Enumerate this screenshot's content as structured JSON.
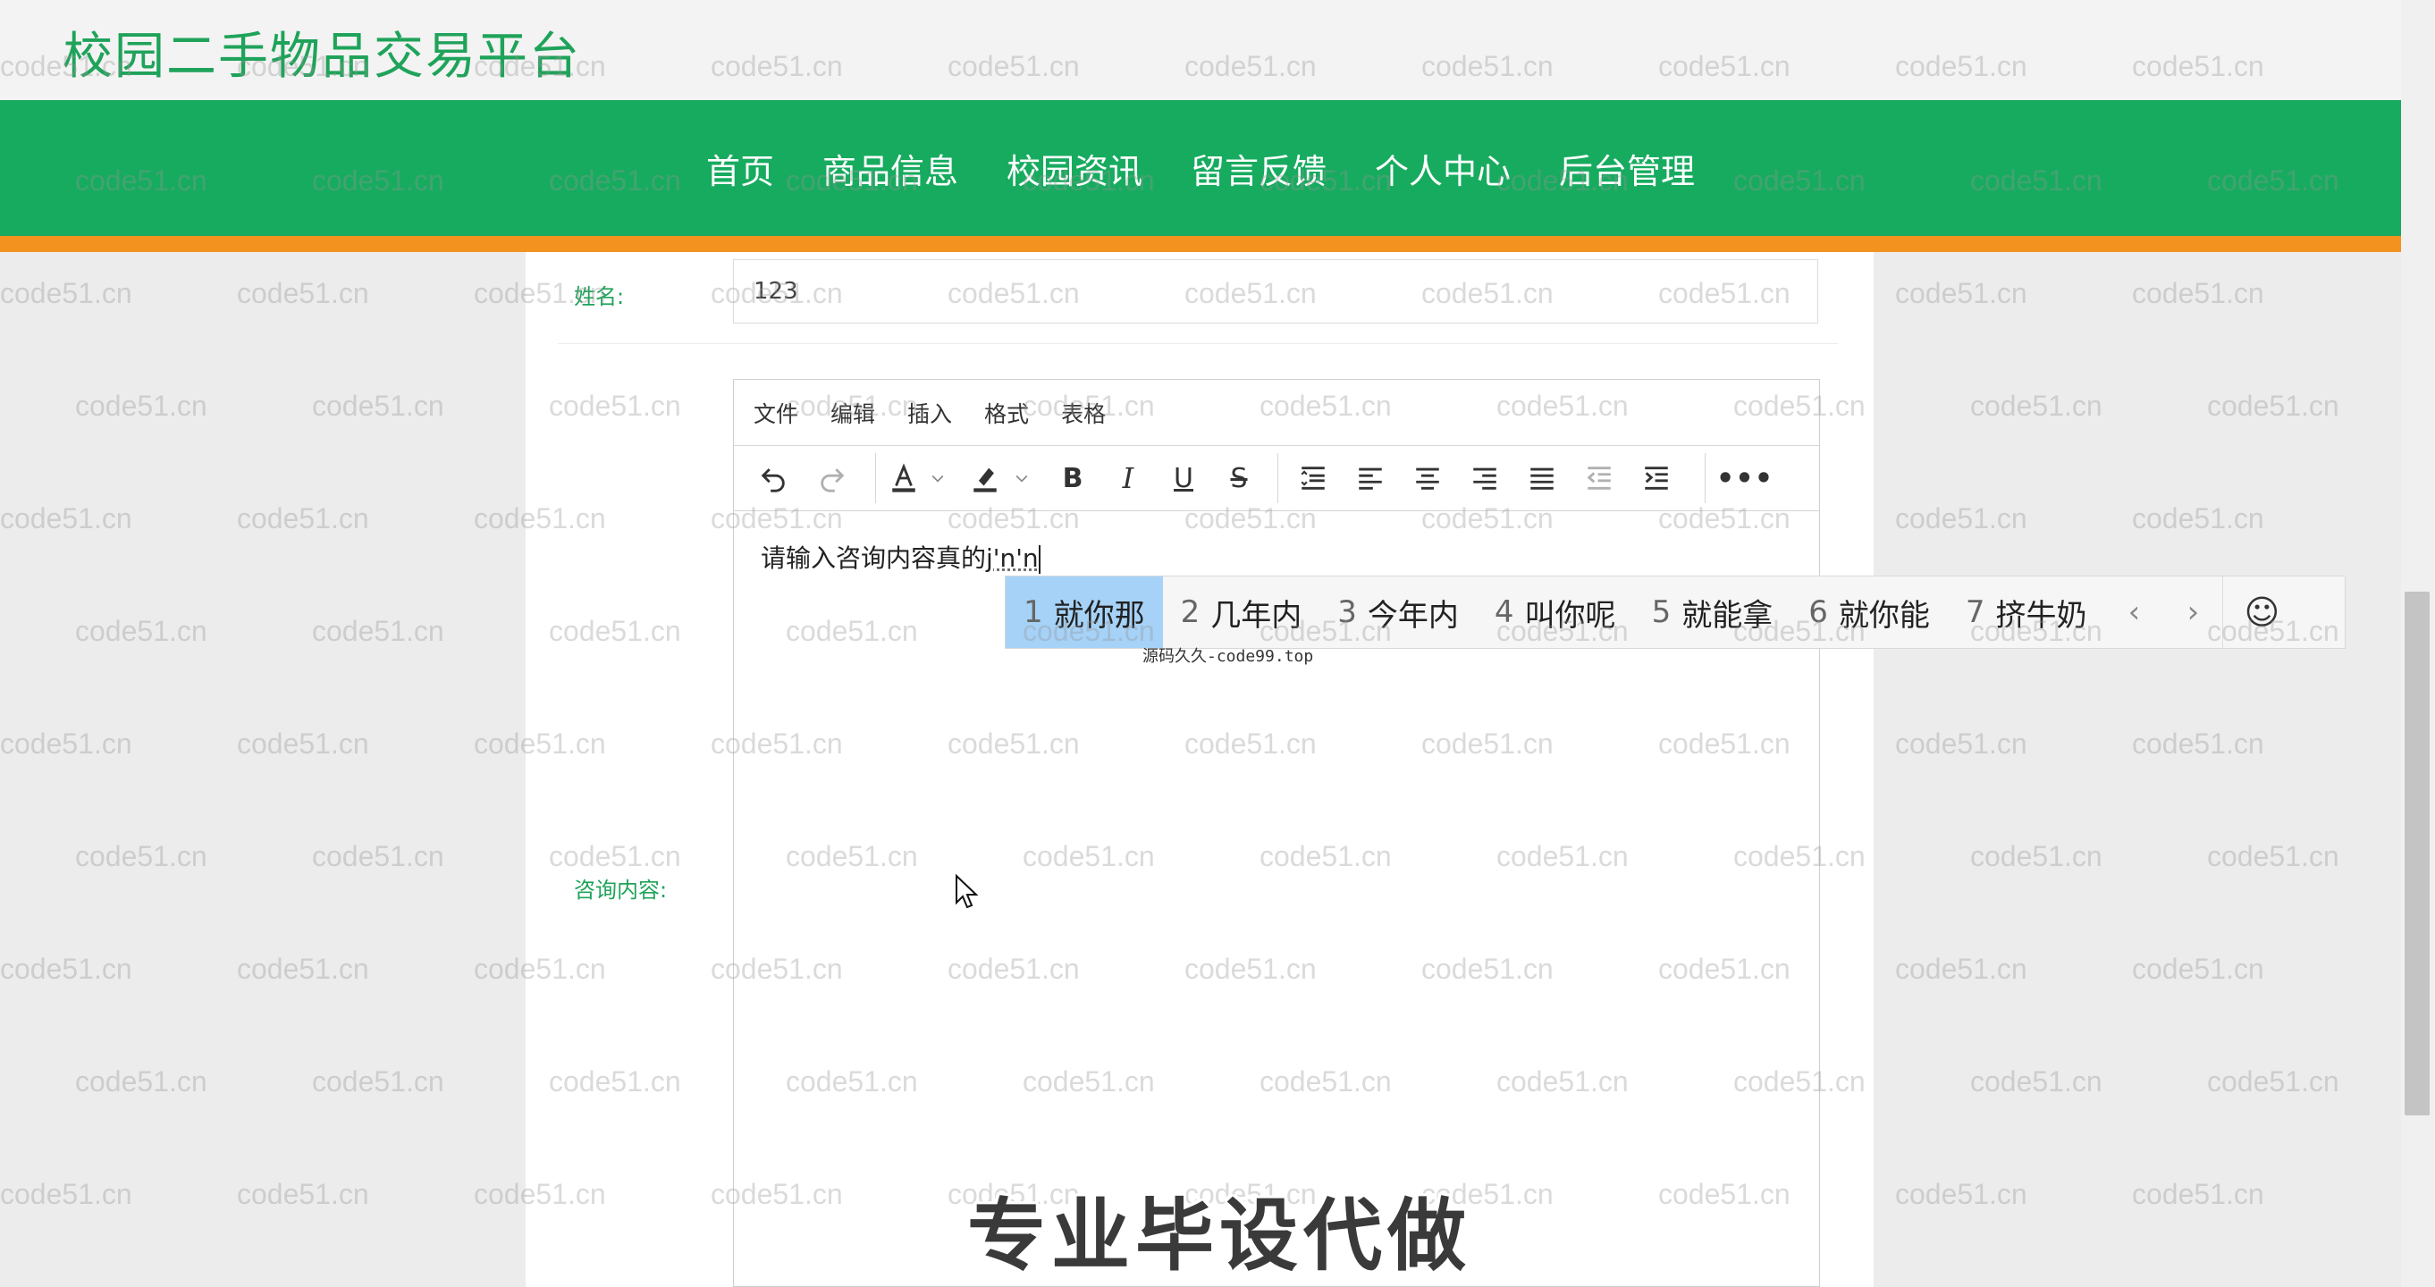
{
  "site": {
    "title": "校园二手物品交易平台"
  },
  "nav": {
    "items": [
      "首页",
      "商品信息",
      "校园资讯",
      "留言反馈",
      "个人中心",
      "后台管理"
    ]
  },
  "form": {
    "name_label": "姓名:",
    "name_value": "123",
    "content_label": "咨询内容:"
  },
  "editor": {
    "menus": [
      "文件",
      "编辑",
      "插入",
      "格式",
      "表格"
    ],
    "toolbar": [
      "undo-icon",
      "redo-icon",
      "font-color-icon",
      "dropdown-icon",
      "highlight-icon",
      "dropdown-icon",
      "bold-icon",
      "italic-icon",
      "underline-icon",
      "strikethrough-icon",
      "line-height-icon",
      "align-left-icon",
      "align-center-icon",
      "align-right-icon",
      "justify-icon",
      "outdent-icon",
      "indent-icon",
      "more-icon"
    ],
    "content_text": "请输入咨询内容真的",
    "composing_text": "j'n'n"
  },
  "ime": {
    "candidates": [
      {
        "num": "1",
        "text": "就你那"
      },
      {
        "num": "2",
        "text": "几年内"
      },
      {
        "num": "3",
        "text": "今年内"
      },
      {
        "num": "4",
        "text": "叫你呢"
      },
      {
        "num": "5",
        "text": "就能拿"
      },
      {
        "num": "6",
        "text": "就你能"
      },
      {
        "num": "7",
        "text": "挤牛奶"
      }
    ],
    "subtext": "源码久久-code99.top",
    "prev_glyph": "‹",
    "next_glyph": "›",
    "emoji_glyph": "☺"
  },
  "watermark": "code51.cn",
  "overlay": {
    "banner": "专业毕设代做"
  },
  "colors": {
    "brand_green": "#17ab5f",
    "accent_orange": "#f3921f",
    "ime_selected": "#a6d2f7"
  }
}
